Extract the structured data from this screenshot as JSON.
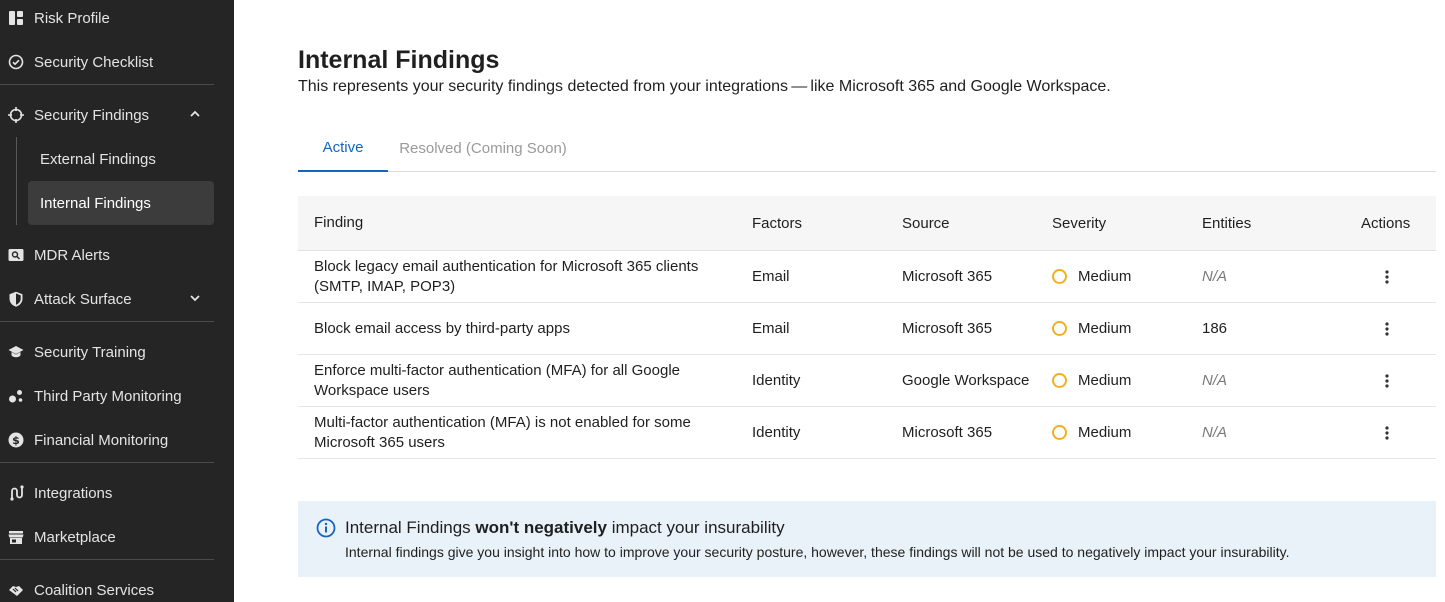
{
  "sidebar": {
    "items": [
      {
        "label": "Risk Profile",
        "icon": "dashboard-icon"
      },
      {
        "label": "Security Checklist",
        "icon": "check-circle-icon"
      },
      {
        "label": "Security Findings",
        "icon": "crosshair-icon",
        "expanded": true
      },
      {
        "label": "MDR Alerts",
        "icon": "search-screen-icon"
      },
      {
        "label": "Attack Surface",
        "icon": "shield-icon",
        "expanded": false
      },
      {
        "label": "Security Training",
        "icon": "graduation-cap-icon"
      },
      {
        "label": "Third Party Monitoring",
        "icon": "network-icon"
      },
      {
        "label": "Financial Monitoring",
        "icon": "dollar-icon"
      },
      {
        "label": "Integrations",
        "icon": "integrations-icon"
      },
      {
        "label": "Marketplace",
        "icon": "store-icon"
      },
      {
        "label": "Coalition Services",
        "icon": "handshake-icon"
      }
    ],
    "sub_items": [
      {
        "label": "External Findings"
      },
      {
        "label": "Internal Findings",
        "active": true
      }
    ]
  },
  "main": {
    "title": "Internal Findings",
    "subtitle": "This represents your security findings detected from your integrations — like Microsoft 365 and Google Workspace.",
    "tabs": [
      {
        "label": "Active",
        "active": true
      },
      {
        "label": "Resolved (Coming Soon)",
        "disabled": true
      }
    ],
    "table": {
      "headers": {
        "finding": "Finding",
        "factors": "Factors",
        "source": "Source",
        "severity": "Severity",
        "entities": "Entities",
        "actions": "Actions"
      },
      "rows": [
        {
          "finding": "Block legacy email authentication for Microsoft 365 clients (SMTP, IMAP, POP3)",
          "factors": "Email",
          "source": "Microsoft 365",
          "severity": "Medium",
          "entities": "N/A"
        },
        {
          "finding": "Block email access by third-party apps",
          "factors": "Email",
          "source": "Microsoft 365",
          "severity": "Medium",
          "entities": "186"
        },
        {
          "finding": "Enforce multi-factor authentication (MFA) for all Google Workspace users",
          "factors": "Identity",
          "source": "Google Workspace",
          "severity": "Medium",
          "entities": "N/A"
        },
        {
          "finding": "Multi-factor authentication (MFA) is not enabled for some Microsoft 365 users",
          "factors": "Identity",
          "source": "Microsoft 365",
          "severity": "Medium",
          "entities": "N/A"
        }
      ]
    },
    "info": {
      "title_prefix": "Internal Findings ",
      "title_bold": "won't negatively",
      "title_suffix": " impact your insurability",
      "body": "Internal findings give you insight into how to improve your security posture, however, these findings will not be used to negatively impact your insurability."
    }
  },
  "colors": {
    "sidebar_bg": "#252525",
    "accent": "#1565c0",
    "severity_medium": "#f2b01e",
    "info_bg": "#e8f2f8"
  }
}
